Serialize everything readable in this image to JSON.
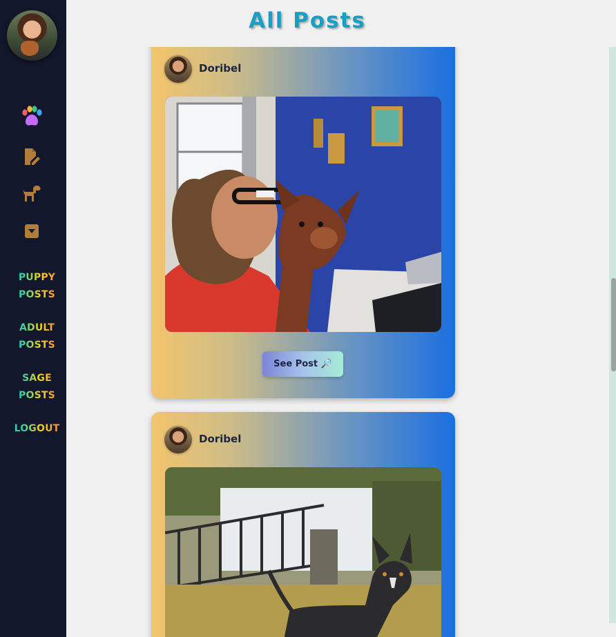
{
  "page": {
    "title": "All Posts"
  },
  "sidebar": {
    "avatar_alt": "profile-avatar",
    "icons": [
      {
        "name": "paw-icon"
      },
      {
        "name": "new-post-icon"
      },
      {
        "name": "dog-icon"
      },
      {
        "name": "dropdown-icon"
      }
    ],
    "links": [
      {
        "line1": "PUPPY",
        "line2": "POSTS"
      },
      {
        "line1": "ADULT",
        "line2": "POSTS"
      },
      {
        "line1": "SAGE",
        "line2": "POSTS"
      }
    ],
    "logout_label": "LOGOUT"
  },
  "posts": [
    {
      "author": "Doribel",
      "button_label": "See Post 🔎"
    },
    {
      "author": "Doribel"
    }
  ],
  "colors": {
    "sidebar_bg": "#12172b",
    "title": "#1a9fc4",
    "card_gradient_start": "#f3c46c",
    "card_gradient_end": "#1a6fe0"
  }
}
